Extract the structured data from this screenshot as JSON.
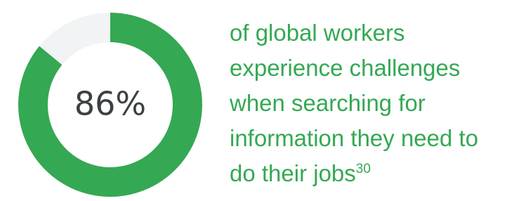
{
  "stat": {
    "value_text": "86%",
    "caption_lines": [
      "of global workers",
      "experience challenges",
      "when searching for",
      "information they need to",
      "do their jobs"
    ],
    "footnote": "30"
  },
  "chart_data": {
    "type": "pie",
    "donut": true,
    "center_label": "86%",
    "slices": [
      {
        "value": 86,
        "color": "#34a853"
      },
      {
        "value": 14,
        "color": "#f1f3f4"
      }
    ]
  },
  "colors": {
    "accent": "#34a853",
    "track": "#f1f3f4",
    "value_text": "#3c4043"
  }
}
